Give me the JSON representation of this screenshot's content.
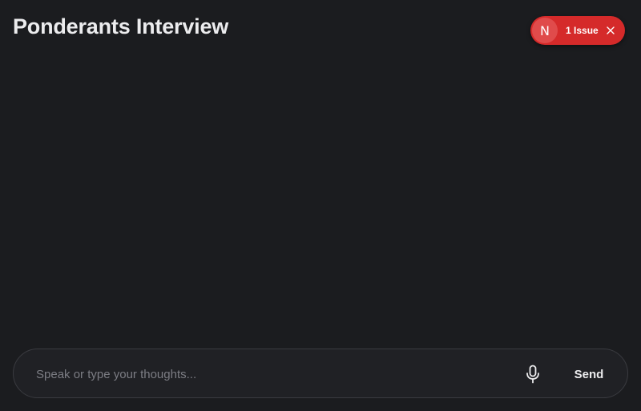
{
  "header": {
    "title": "Ponderants Interview"
  },
  "issue_badge": {
    "avatar_letter": "N",
    "label": "1 Issue",
    "close_icon": "close-icon",
    "color": "#d52a2a"
  },
  "composer": {
    "placeholder": "Speak or type your thoughts...",
    "value": "",
    "mic_icon": "microphone-icon",
    "send_label": "Send"
  },
  "theme": {
    "background": "#1b1c1f",
    "text": "#ececee"
  }
}
